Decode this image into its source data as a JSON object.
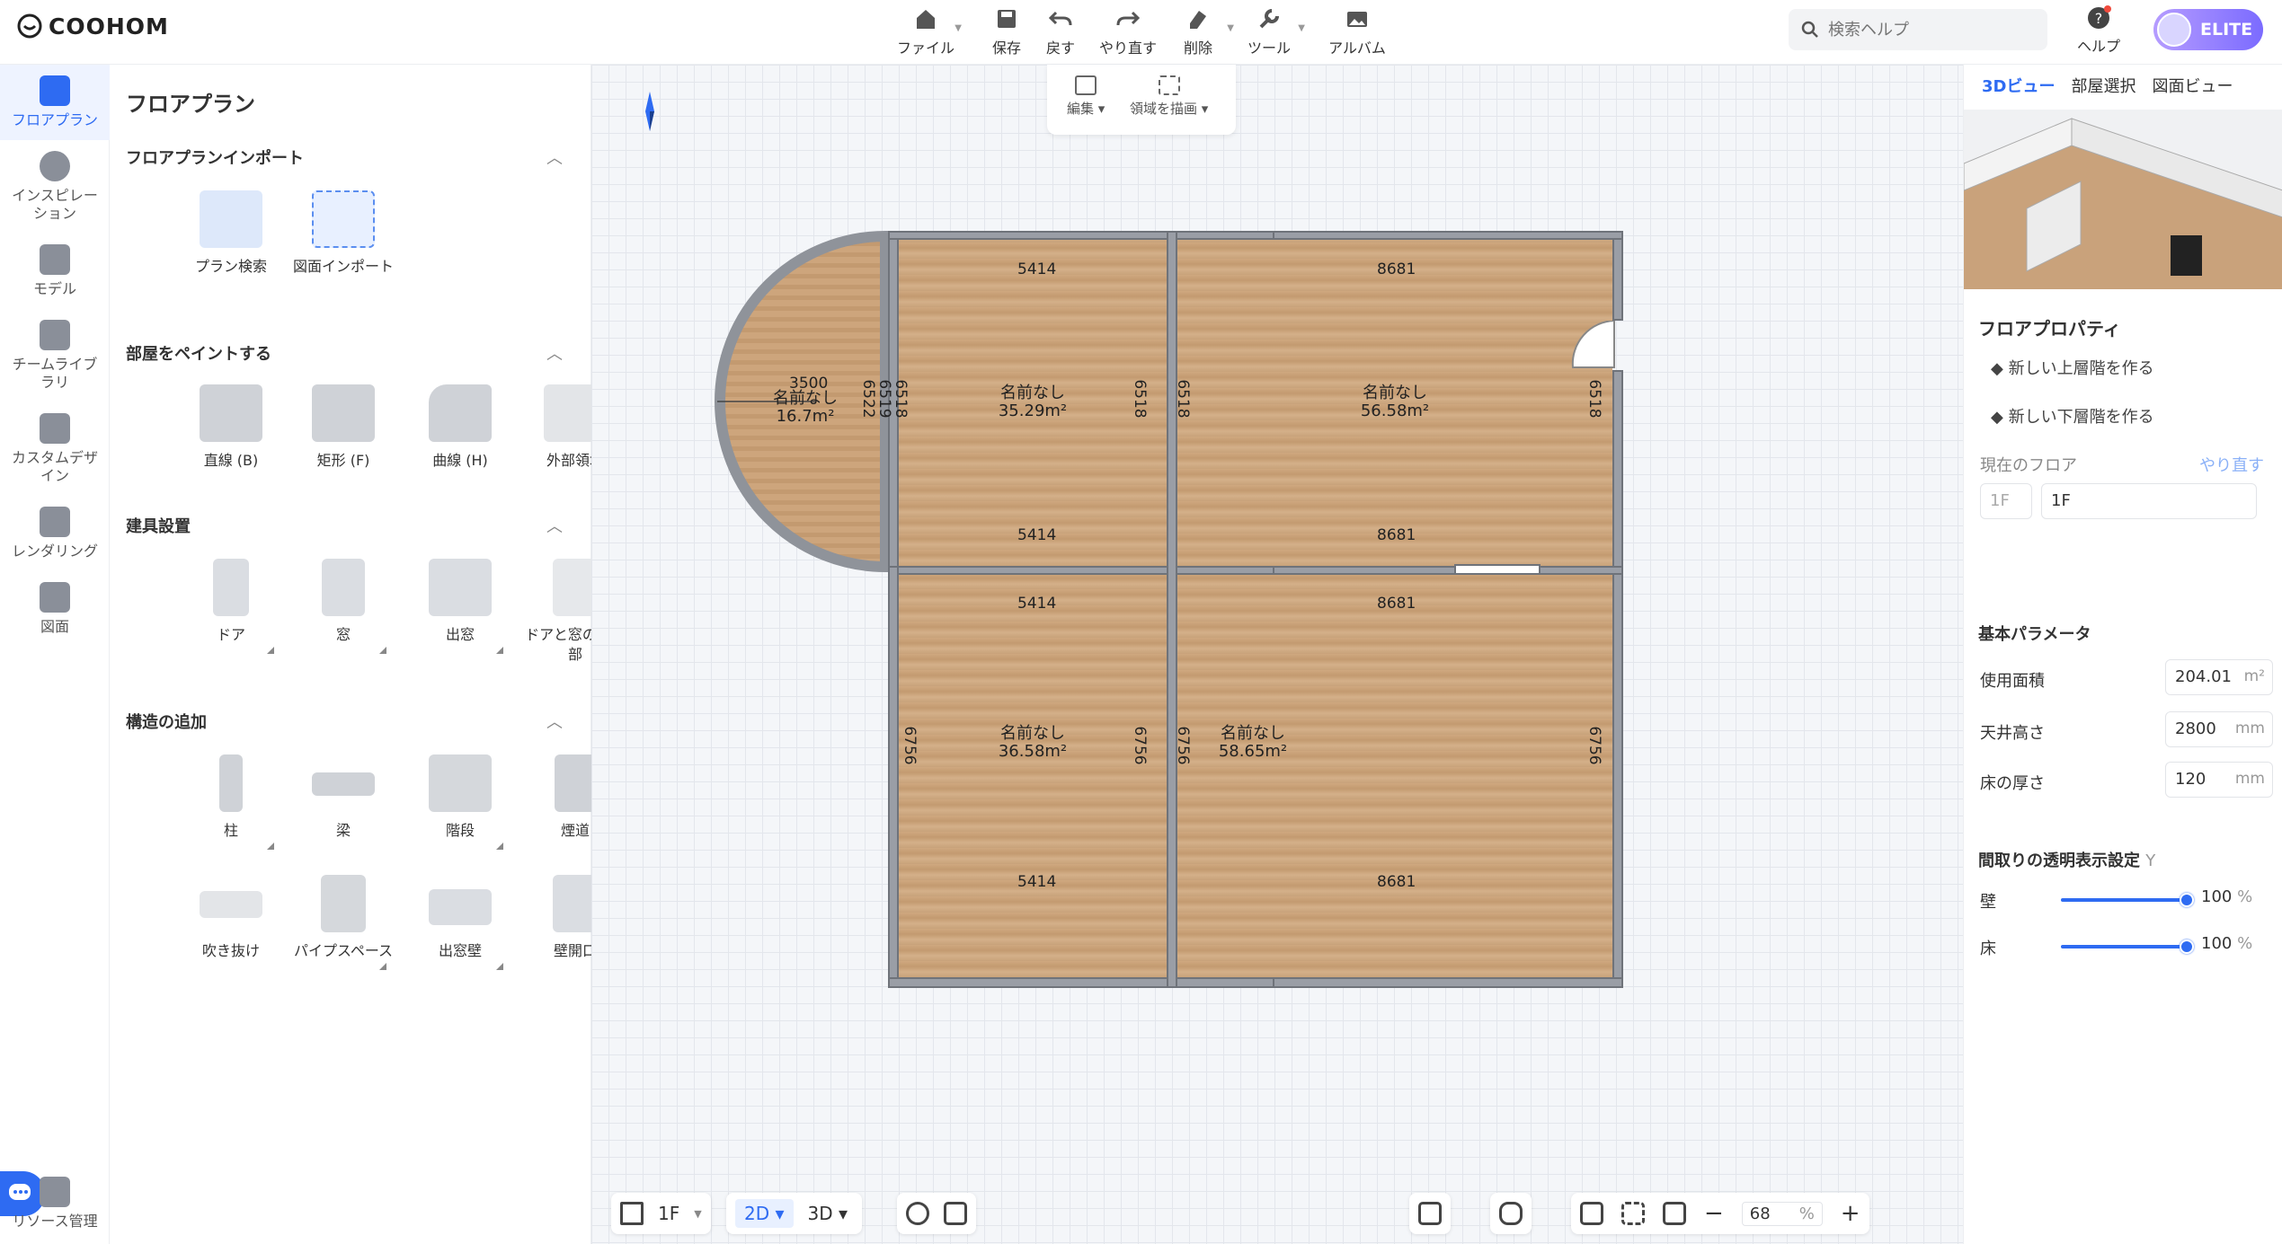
{
  "app": {
    "brand": "COOHOM"
  },
  "toolbar": {
    "file": "ファイル",
    "save": "保存",
    "undo": "戻す",
    "redo": "やり直す",
    "delete": "削除",
    "tools": "ツール",
    "album": "アルバム"
  },
  "search": {
    "placeholder": "検索ヘルプ"
  },
  "help": {
    "label": "ヘルプ"
  },
  "account": {
    "badge": "ELITE"
  },
  "leftnav": [
    {
      "label": "フロアプラン"
    },
    {
      "label": "インスピレーション"
    },
    {
      "label": "モデル"
    },
    {
      "label": "チームライブラリ"
    },
    {
      "label": "カスタムデザイン"
    },
    {
      "label": "レンダリング"
    },
    {
      "label": "図面"
    }
  ],
  "leftnav_bottom": {
    "label": "リソース管理"
  },
  "panel": {
    "title": "フロアプラン",
    "sec_import": "フロアプランインポート",
    "plan_search": "プラン検索",
    "drawing_import": "図面インポート",
    "sec_paint": "部屋をペイントする",
    "straight": "直線 (B)",
    "rect": "矩形 (F)",
    "curve": "曲線 (H)",
    "outer": "外部領域",
    "sec_fixtures": "建具設置",
    "door": "ドア",
    "window": "窓",
    "bay": "出窓",
    "opening": "ドアと窓の開口部",
    "sec_struct": "構造の追加",
    "column": "柱",
    "beam": "梁",
    "stairs": "階段",
    "chimney": "煙道",
    "void": "吹き抜け",
    "pipe": "パイプスペース",
    "baywall": "出窓壁",
    "wallopen": "壁開口"
  },
  "subtoolbar": {
    "edit": "編集",
    "draw_area": "領域を描画"
  },
  "plan": {
    "rooms": [
      {
        "name": "名前なし",
        "area": "16.7m²",
        "dim_top": "3500",
        "dim_side": "6522"
      },
      {
        "name": "名前なし",
        "area": "35.29m²",
        "dim_top": "5414",
        "dim_bottom": "5414",
        "dim_left": "6518",
        "dim_right": "6518"
      },
      {
        "name": "名前なし",
        "area": "56.58m²",
        "dim_top": "8681",
        "dim_bottom": "8681",
        "dim_left": "6518",
        "dim_right": "6518"
      },
      {
        "name": "名前なし",
        "area": "36.58m²",
        "dim_top": "5414",
        "dim_bottom": "5414",
        "dim_left": "6756",
        "dim_right": "6756"
      },
      {
        "name": "名前なし",
        "area": "58.65m²",
        "dim_top": "8681",
        "dim_bottom": "8681",
        "dim_left": "6756",
        "dim_right": "6756"
      }
    ],
    "extra_dim": "6519"
  },
  "bottombar": {
    "floor": "1F",
    "mode2d": "2D",
    "mode3d": "3D",
    "zoom": "68",
    "zoom_unit": "%"
  },
  "right": {
    "tabs": [
      "3Dビュー",
      "部屋選択",
      "図面ビュー"
    ],
    "props_title": "フロアプロパティ",
    "new_upper": "新しい上層階を作る",
    "new_lower": "新しい下層階を作る",
    "current_floor": "現在のフロア",
    "redo_link": "やり直す",
    "floor_select": "1F",
    "floor_name": "1F",
    "basic": "基本パラメータ",
    "area_label": "使用面積",
    "area_value": "204.01",
    "area_unit": "m²",
    "ceiling_label": "天井高さ",
    "ceiling_value": "2800",
    "ceiling_unit": "mm",
    "thick_label": "床の厚さ",
    "thick_value": "120",
    "thick_unit": "mm",
    "transp": "間取りの透明表示設定",
    "transp_key": "Y",
    "wall": "壁",
    "wall_value": "100",
    "floor": "床",
    "floor_value": "100",
    "pct": "%"
  }
}
